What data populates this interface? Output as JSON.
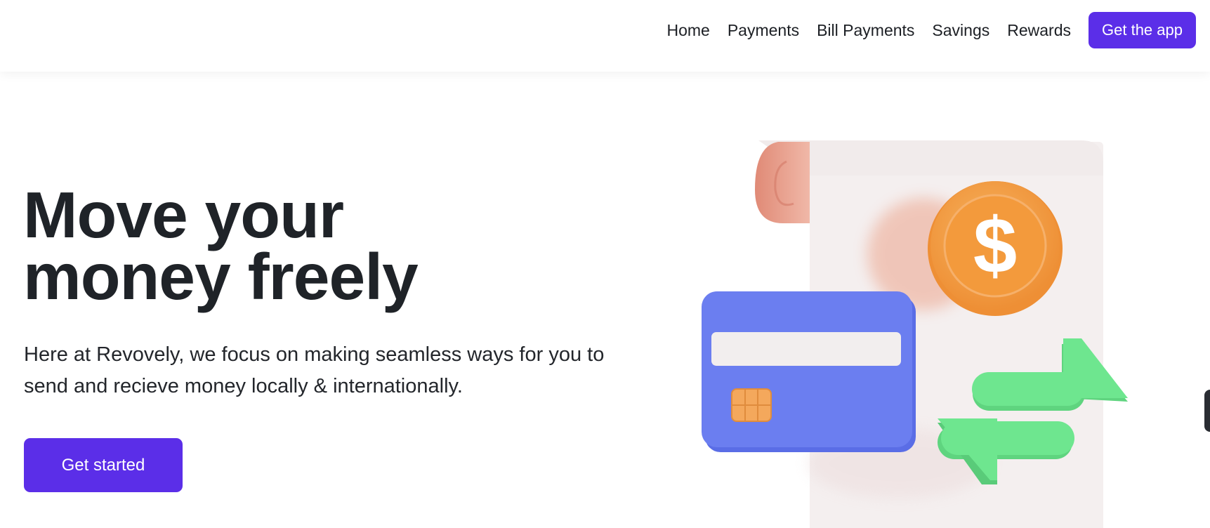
{
  "nav": {
    "items": [
      {
        "label": "Home"
      },
      {
        "label": "Payments"
      },
      {
        "label": "Bill Payments"
      },
      {
        "label": "Savings"
      },
      {
        "label": "Rewards"
      }
    ],
    "cta_label": "Get the app"
  },
  "hero": {
    "title_line1": "Move your",
    "title_line2": "money freely",
    "description": "Here at Revovely, we focus on making seamless ways for you to send and recieve money locally & internationally.",
    "cta_label": "Get started"
  },
  "illustration": {
    "icons": [
      "receipt-icon",
      "dollar-coin-icon",
      "credit-card-icon",
      "transfer-arrows-icon"
    ],
    "coin_symbol": "$"
  },
  "colors": {
    "brand": "#5b2ee8",
    "heading": "#1f2328",
    "card": "#6b7ef0",
    "coin": "#f5a347",
    "arrows": "#68e08a",
    "receipt": "#f4efef",
    "receipt_curl": "#e49a86"
  }
}
